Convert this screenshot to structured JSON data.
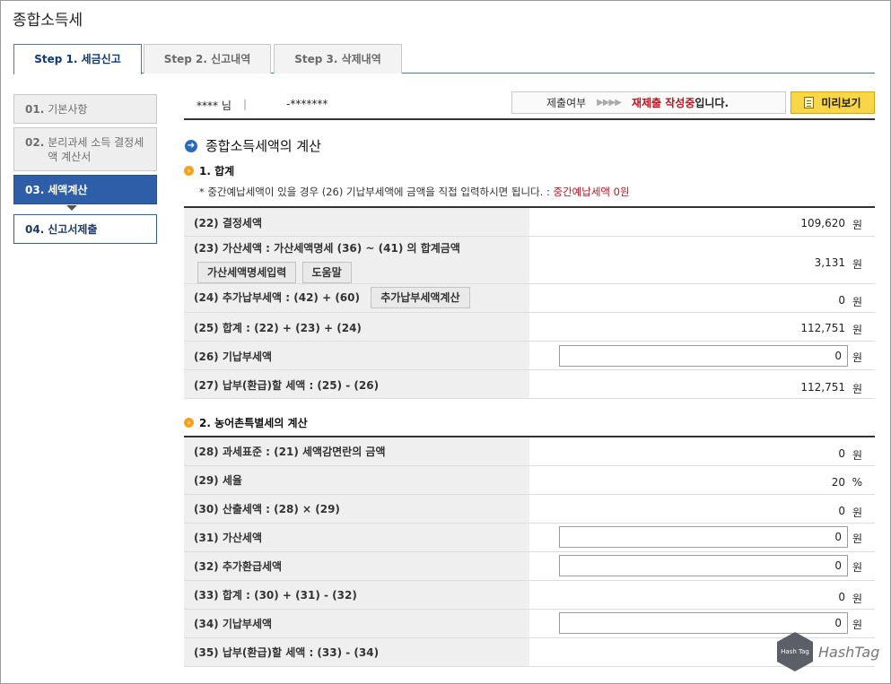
{
  "page": {
    "title": "종합소득세"
  },
  "tabs": [
    {
      "label": "Step 1. 세금신고"
    },
    {
      "label": "Step 2. 신고내역"
    },
    {
      "label": "Step 3. 삭제내역"
    }
  ],
  "sidebar": {
    "items": [
      {
        "num": "01.",
        "label": "기본사항"
      },
      {
        "num": "02.",
        "label": "분리과세 소득 결정세액 계산서"
      },
      {
        "num": "03.",
        "label": "세액계산"
      },
      {
        "num": "04.",
        "label": "신고서제출"
      }
    ]
  },
  "userbar": {
    "name": "**** 님",
    "separator": "|",
    "id": "-*******",
    "status_label": "제출여부",
    "status_arrows": "▶▶▶▶",
    "status_value": "재제출 작성중",
    "status_tail": "입니다.",
    "preview_label": "미리보기"
  },
  "section": {
    "title": "종합소득세액의 계산",
    "sub1": "1. 합계",
    "note_prefix": "* 중간예납세액이 있을 경우 (26) 기납부세액에 금액을 직접 입력하시면 됩니다. : ",
    "note_value": "중간예납세액 0원",
    "sub2": "2. 농어촌특별세의 계산"
  },
  "table1": {
    "r22": {
      "label": "(22) 결정세액",
      "value": "109,620",
      "unit": "원"
    },
    "r23": {
      "label": "(23) 가산세액 : 가산세액명세 (36) ~ (41) 의 합계금액",
      "value": "3,131",
      "unit": "원",
      "btn1": "가산세액명세입력",
      "btn2": "도움말"
    },
    "r24": {
      "label": "(24) 추가납부세액 : (42) + (60)",
      "value": "0",
      "unit": "원",
      "btn": "추가납부세액계산"
    },
    "r25": {
      "label": "(25) 합계 : (22) + (23) + (24)",
      "value": "112,751",
      "unit": "원"
    },
    "r26": {
      "label": "(26) 기납부세액",
      "value": "0",
      "unit": "원"
    },
    "r27": {
      "label": "(27) 납부(환급)할 세액 : (25) - (26)",
      "value": "112,751",
      "unit": "원"
    }
  },
  "table2": {
    "r28": {
      "label": "(28) 과세표준 : (21) 세액감면란의 금액",
      "value": "0",
      "unit": "원"
    },
    "r29": {
      "label": "(29) 세율",
      "value": "20",
      "unit": "%"
    },
    "r30": {
      "label": "(30) 산출세액 : (28) × (29)",
      "value": "0",
      "unit": "원"
    },
    "r31": {
      "label": "(31) 가산세액",
      "value": "0",
      "unit": "원"
    },
    "r32": {
      "label": "(32) 추가환급세액",
      "value": "0",
      "unit": "원"
    },
    "r33": {
      "label": "(33) 합계 : (30) + (31) - (32)",
      "value": "0",
      "unit": "원"
    },
    "r34": {
      "label": "(34) 기납부세액",
      "value": "0",
      "unit": "원"
    },
    "r35": {
      "label": "(35) 납부(환급)할 세액 : (33) - (34)"
    }
  },
  "watermark": {
    "badge": "Hash Tag",
    "text": "HashTag"
  }
}
